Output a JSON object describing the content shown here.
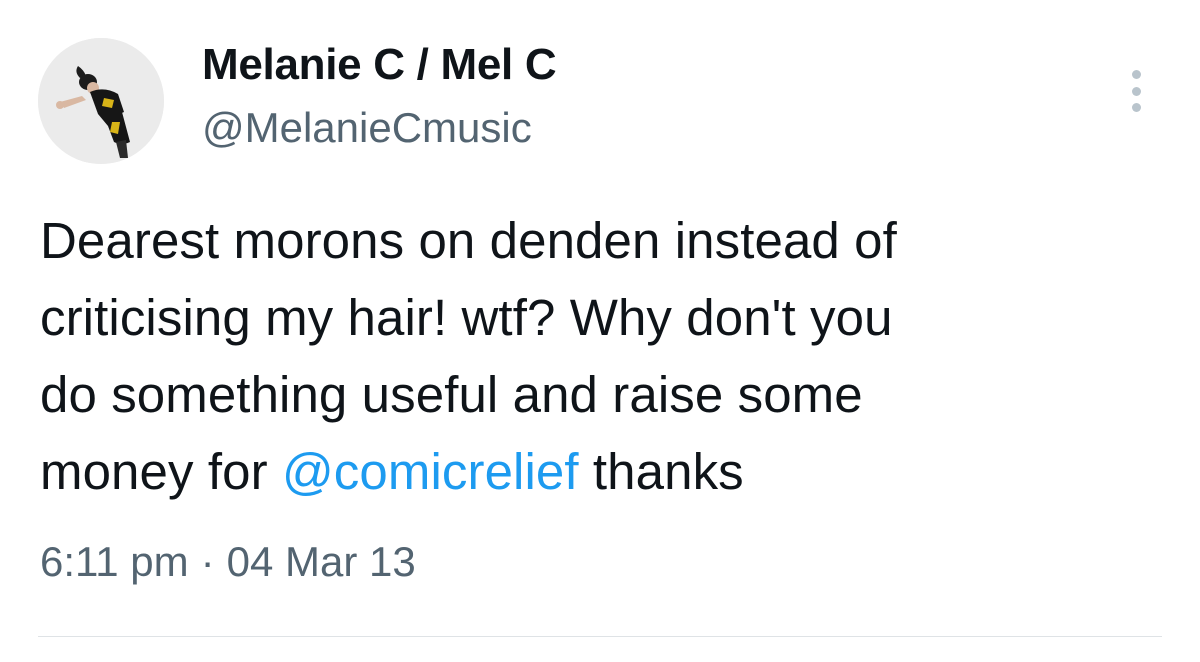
{
  "author": {
    "display_name": "Melanie C / Mel C",
    "handle": "@MelanieCmusic",
    "avatar_icon": "profile-photo-icon"
  },
  "more_icon": "more-options-icon",
  "tweet": {
    "text_lines": [
      "Dearest morons on denden instead of",
      "criticising my hair! wtf? Why don't you",
      "do something useful and raise some"
    ],
    "last_line_prefix": "money for ",
    "mention": "@comicrelief",
    "last_line_suffix": " thanks"
  },
  "meta": {
    "time": "6:11 pm",
    "separator": "·",
    "date": "04 Mar 13"
  },
  "colors": {
    "text": "#0f1419",
    "secondary": "#536471",
    "link": "#1d9bf0"
  }
}
